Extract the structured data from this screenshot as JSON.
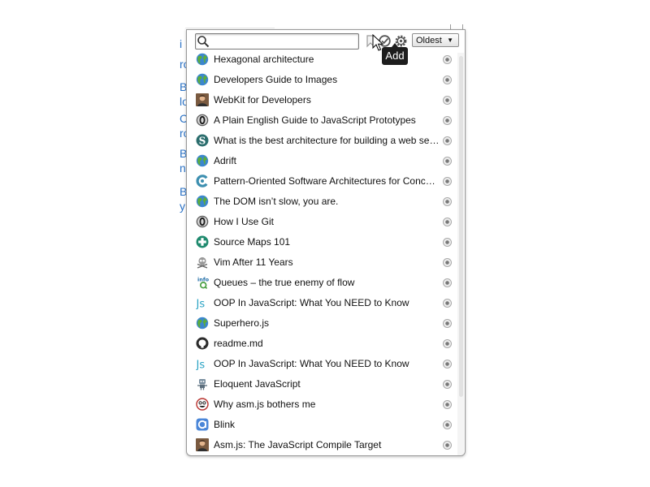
{
  "background_fragments": [
    "i",
    "ro",
    "Ba",
    "lo",
    "C",
    "ro",
    "Ba",
    "nt",
    "Bi",
    "y"
  ],
  "search": {
    "value": "",
    "placeholder": ""
  },
  "toolbar": {
    "bookmark_icon": "bookmark-icon",
    "add_icon": "add-icon",
    "settings_icon": "gear-icon",
    "sort_value": "Oldest",
    "tooltip": "Add"
  },
  "items": [
    {
      "title": "Hexagonal architecture",
      "icon": "globe-icon"
    },
    {
      "title": "Developers Guide to Images",
      "icon": "globe-icon"
    },
    {
      "title": "WebKit for Developers",
      "icon": "avatar-icon"
    },
    {
      "title": "A Plain English Guide to JavaScript Prototypes",
      "icon": "zero-icon"
    },
    {
      "title": "What is the best architecture for building a web service?",
      "icon": "s-icon"
    },
    {
      "title": "Adrift",
      "icon": "globe-icon"
    },
    {
      "title": "Pattern-Oriented Software Architectures for Concurrent Objects",
      "icon": "c-arc-icon"
    },
    {
      "title": "The DOM isn’t slow, you are.",
      "icon": "globe-icon"
    },
    {
      "title": "How I Use Git",
      "icon": "zero-icon"
    },
    {
      "title": "Source Maps 101",
      "icon": "plus-icon"
    },
    {
      "title": "Vim After 11 Years",
      "icon": "skull-icon"
    },
    {
      "title": "Queues – the true enemy of flow",
      "icon": "infoq-icon"
    },
    {
      "title": "OOP In JavaScript: What You NEED to Know",
      "icon": "js-icon"
    },
    {
      "title": "Superhero.js",
      "icon": "globe-icon"
    },
    {
      "title": "readme.md",
      "icon": "github-icon"
    },
    {
      "title": "OOP In JavaScript: What You NEED to Know",
      "icon": "js-icon"
    },
    {
      "title": "Eloquent JavaScript",
      "icon": "robot-icon"
    },
    {
      "title": "Why asm.js bothers me",
      "icon": "face-icon"
    },
    {
      "title": "Blink",
      "icon": "blink-icon"
    },
    {
      "title": "Asm.js: The JavaScript Compile Target",
      "icon": "avatar-icon"
    }
  ]
}
